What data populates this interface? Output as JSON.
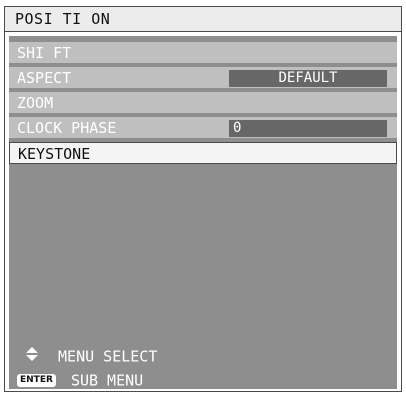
{
  "menu": {
    "title": "POSI TI ON",
    "items": [
      {
        "label": "SHI FT"
      },
      {
        "label": "ASPECT",
        "value": "DEFAULT"
      },
      {
        "label": "ZOOM"
      },
      {
        "label": "CLOCK PHASE",
        "value": "0"
      },
      {
        "label": "KEYSTONE",
        "selected": true
      }
    ]
  },
  "footer": {
    "select_icon": "up-down-arrow-icon",
    "select_label": "MENU SELECT",
    "enter_badge": "ENTER",
    "enter_label": "SUB MENU"
  },
  "colors": {
    "panel_background": "#8e8e8e",
    "item_background": "#bfbfbf",
    "value_background": "#676767",
    "selected_background": "#f4f4f4"
  }
}
